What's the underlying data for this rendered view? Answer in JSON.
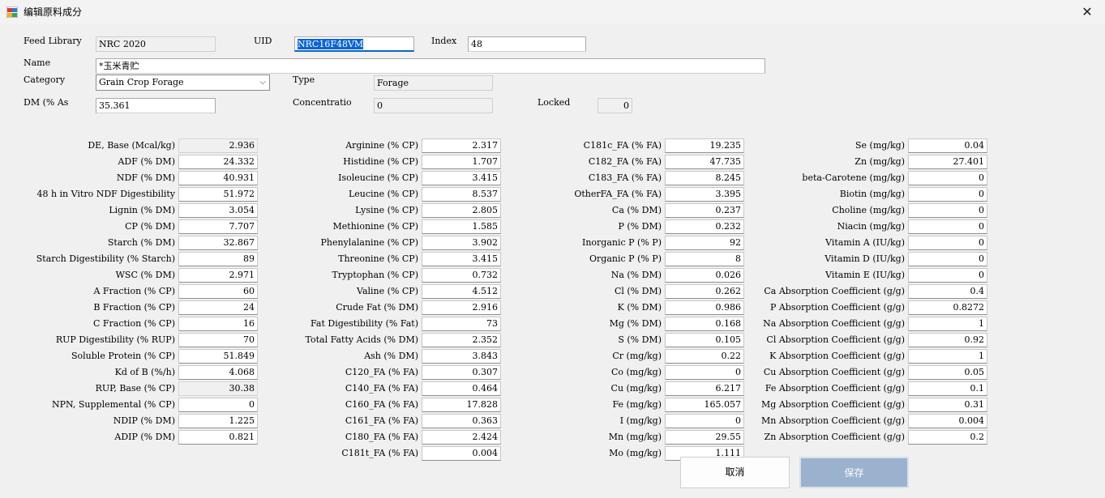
{
  "window": {
    "title": "编辑原料成分",
    "close_glyph": "✕"
  },
  "header": {
    "feed_library_label": "Feed Library",
    "feed_library_value": "NRC 2020",
    "uid_label": "UID",
    "uid_value": "NRC16F48VM",
    "index_label": "Index",
    "index_value": "48",
    "name_label": "Name",
    "name_value": "*玉米青贮",
    "category_label": "Category",
    "category_value": "Grain Crop Forage",
    "type_label": "Type",
    "type_value": "Forage",
    "dm_label": "DM (% As",
    "dm_value": "35.361",
    "concentration_label": "Concentratio",
    "concentration_value": "0",
    "locked_label": "Locked",
    "locked_value": "0"
  },
  "columns": [
    {
      "rows": [
        {
          "label": "DE, Base (Mcal/kg)",
          "value": "2.936",
          "readonly": true
        },
        {
          "label": "ADF (% DM)",
          "value": "24.332"
        },
        {
          "label": "NDF (% DM)",
          "value": "40.931"
        },
        {
          "label": "48 h in Vitro NDF Digestibility",
          "value": "51.972"
        },
        {
          "label": "Lignin (% DM)",
          "value": "3.054"
        },
        {
          "label": "CP (% DM)",
          "value": "7.707"
        },
        {
          "label": "Starch (% DM)",
          "value": "32.867"
        },
        {
          "label": "Starch Digestibility (%  Starch)",
          "value": "89"
        },
        {
          "label": "WSC (% DM)",
          "value": "2.971"
        },
        {
          "label": "A Fraction (% CP)",
          "value": "60"
        },
        {
          "label": "B Fraction (% CP)",
          "value": "24"
        },
        {
          "label": "C Fraction (% CP)",
          "value": "16"
        },
        {
          "label": "RUP Digestibility (% RUP)",
          "value": "70"
        },
        {
          "label": "Soluble Protein (% CP)",
          "value": "51.849"
        },
        {
          "label": "Kd of B (%/h)",
          "value": "4.068"
        },
        {
          "label": "RUP, Base (% CP)",
          "value": "30.38",
          "readonly": true
        },
        {
          "label": "NPN, Supplemental (% CP)",
          "value": "0"
        },
        {
          "label": "NDIP (% DM)",
          "value": "1.225"
        },
        {
          "label": "ADIP (% DM)",
          "value": "0.821"
        }
      ]
    },
    {
      "rows": [
        {
          "label": "Arginine (% CP)",
          "value": "2.317"
        },
        {
          "label": "Histidine (% CP)",
          "value": "1.707"
        },
        {
          "label": "Isoleucine (% CP)",
          "value": "3.415"
        },
        {
          "label": "Leucine (% CP)",
          "value": "8.537"
        },
        {
          "label": "Lysine (% CP)",
          "value": "2.805"
        },
        {
          "label": "Methionine (% CP)",
          "value": "1.585"
        },
        {
          "label": "Phenylalanine (% CP)",
          "value": "3.902"
        },
        {
          "label": "Threonine (% CP)",
          "value": "3.415"
        },
        {
          "label": "Tryptophan (% CP)",
          "value": "0.732"
        },
        {
          "label": "Valine (% CP)",
          "value": "4.512"
        },
        {
          "label": "Crude Fat (% DM)",
          "value": "2.916"
        },
        {
          "label": "Fat Digestibility (% Fat)",
          "value": "73"
        },
        {
          "label": "Total Fatty Acids (% DM)",
          "value": "2.352"
        },
        {
          "label": "Ash (% DM)",
          "value": "3.843"
        },
        {
          "label": "C120_FA (% FA)",
          "value": "0.307"
        },
        {
          "label": "C140_FA (% FA)",
          "value": "0.464"
        },
        {
          "label": "C160_FA (% FA)",
          "value": "17.828"
        },
        {
          "label": "C161_FA (% FA)",
          "value": "0.363"
        },
        {
          "label": "C180_FA (% FA)",
          "value": "2.424"
        },
        {
          "label": "C181t_FA (% FA)",
          "value": "0.004"
        }
      ]
    },
    {
      "rows": [
        {
          "label": "C181c_FA (% FA)",
          "value": "19.235"
        },
        {
          "label": "C182_FA (% FA)",
          "value": "47.735"
        },
        {
          "label": "C183_FA (% FA)",
          "value": "8.245"
        },
        {
          "label": "OtherFA_FA (% FA)",
          "value": "3.395"
        },
        {
          "label": "Ca (% DM)",
          "value": "0.237"
        },
        {
          "label": "P (% DM)",
          "value": "0.232"
        },
        {
          "label": "Inorganic P (% P)",
          "value": "92"
        },
        {
          "label": "Organic P (% P)",
          "value": "8"
        },
        {
          "label": "Na (% DM)",
          "value": "0.026"
        },
        {
          "label": "Cl (% DM)",
          "value": "0.262"
        },
        {
          "label": "K (% DM)",
          "value": "0.986"
        },
        {
          "label": "Mg (% DM)",
          "value": "0.168"
        },
        {
          "label": "S (% DM)",
          "value": "0.105"
        },
        {
          "label": "Cr (mg/kg)",
          "value": "0.22"
        },
        {
          "label": "Co (mg/kg)",
          "value": "0"
        },
        {
          "label": "Cu (mg/kg)",
          "value": "6.217"
        },
        {
          "label": "Fe (mg/kg)",
          "value": "165.057"
        },
        {
          "label": "I (mg/kg)",
          "value": "0"
        },
        {
          "label": "Mn (mg/kg)",
          "value": "29.55"
        },
        {
          "label": "Mo (mg/kg)",
          "value": "1.111"
        }
      ]
    },
    {
      "rows": [
        {
          "label": "Se (mg/kg)",
          "value": "0.04"
        },
        {
          "label": "Zn (mg/kg)",
          "value": "27.401"
        },
        {
          "label": "beta-Carotene (mg/kg)",
          "value": "0"
        },
        {
          "label": "Biotin (mg/kg)",
          "value": "0"
        },
        {
          "label": "Choline (mg/kg)",
          "value": "0"
        },
        {
          "label": "Niacin (mg/kg)",
          "value": "0"
        },
        {
          "label": "Vitamin A (IU/kg)",
          "value": "0"
        },
        {
          "label": "Vitamin D (IU/kg)",
          "value": "0"
        },
        {
          "label": "Vitamin E (IU/kg)",
          "value": "0"
        },
        {
          "label": "Ca Absorption Coefficient (g/g)",
          "value": "0.4"
        },
        {
          "label": "P  Absorption Coefficient (g/g)",
          "value": "0.8272"
        },
        {
          "label": "Na  Absorption Coefficient (g/g)",
          "value": "1"
        },
        {
          "label": "Cl  Absorption Coefficient (g/g)",
          "value": "0.92"
        },
        {
          "label": "K  Absorption Coefficient (g/g)",
          "value": "1"
        },
        {
          "label": "Cu  Absorption Coefficient (g/g)",
          "value": "0.05"
        },
        {
          "label": "Fe  Absorption Coefficient (g/g)",
          "value": "0.1"
        },
        {
          "label": "Mg  Absorption Coefficient (g/g)",
          "value": "0.31"
        },
        {
          "label": "Mn  Absorption Coefficient (g/g)",
          "value": "0.004"
        },
        {
          "label": "Zn  Absorption Coefficient (g/g)",
          "value": "0.2"
        }
      ]
    }
  ],
  "buttons": {
    "cancel": "取消",
    "save": "保存"
  },
  "colors": {
    "accent": "#0a64d6",
    "save_button": "#9bb2cf"
  }
}
